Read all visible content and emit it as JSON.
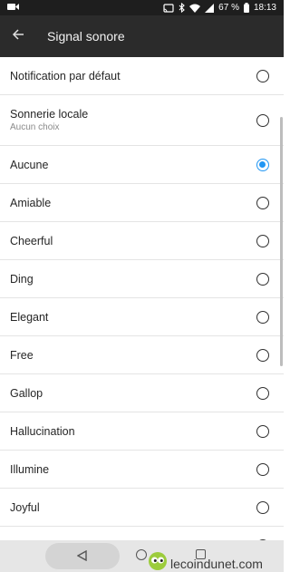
{
  "status_bar": {
    "battery_percent": "67 %",
    "time": "18:13"
  },
  "app_bar": {
    "title": "Signal sonore"
  },
  "list": {
    "items": [
      {
        "label": "Notification par défaut",
        "sublabel": "",
        "selected": false
      },
      {
        "label": "Sonnerie locale",
        "sublabel": "Aucun choix",
        "selected": false
      },
      {
        "label": "Aucune",
        "sublabel": "",
        "selected": true
      },
      {
        "label": "Amiable",
        "sublabel": "",
        "selected": false
      },
      {
        "label": "Cheerful",
        "sublabel": "",
        "selected": false
      },
      {
        "label": "Ding",
        "sublabel": "",
        "selected": false
      },
      {
        "label": "Elegant",
        "sublabel": "",
        "selected": false
      },
      {
        "label": "Free",
        "sublabel": "",
        "selected": false
      },
      {
        "label": "Gallop",
        "sublabel": "",
        "selected": false
      },
      {
        "label": "Hallucination",
        "sublabel": "",
        "selected": false
      },
      {
        "label": "Illumine",
        "sublabel": "",
        "selected": false
      },
      {
        "label": "Joyful",
        "sublabel": "",
        "selected": false
      },
      {
        "label": "",
        "sublabel": "",
        "selected": false
      }
    ]
  },
  "watermark": {
    "text": "lecoindunet.com"
  },
  "colors": {
    "accent": "#2196f3",
    "app_bar": "#2b2b2b",
    "status_bar": "#1e1e1e"
  }
}
